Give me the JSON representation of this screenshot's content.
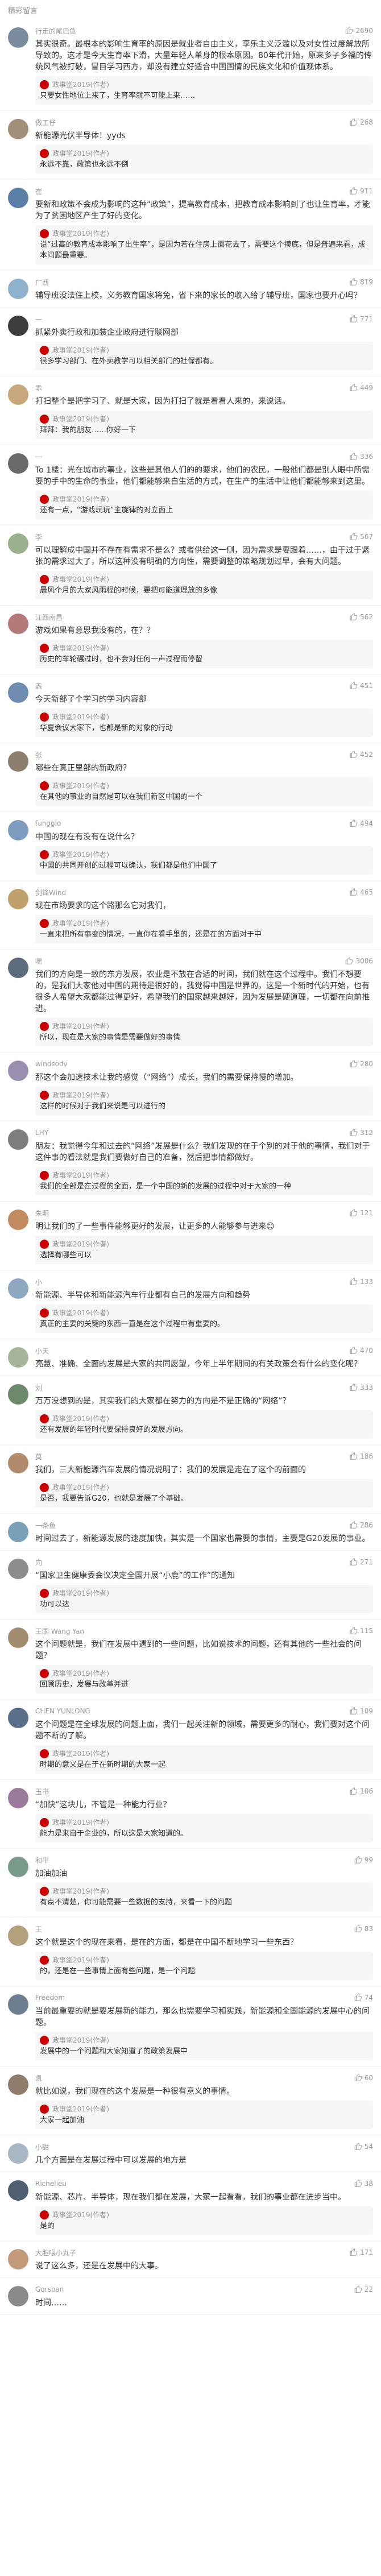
{
  "header": {
    "title": "精彩留言"
  },
  "comments": [
    {
      "user": "行走的尾巴鱼",
      "avatar_color": "#7a8a9f",
      "likes": "2690",
      "text": "其实很奇。最根本的影响生育率的原因是就业者自由主义，享乐主义泛滥以及对女性过度解放所导致的。这才是今天生育率下滑，大量年轻人单身的根本原因。80年代开始，原来多子多福的传统风气被打破，冒目学习西方，却没有建立好适合中国国情的民族文化和价值观体系。",
      "reply": {
        "name": "政事堂2019(作者)",
        "text": "只要女性地位上来了，生育率就不可能上来……"
      }
    },
    {
      "user": "做工仔",
      "avatar_color": "#a28f79",
      "likes": "268",
      "text": "新能源光伏半导体！yyds",
      "reply": {
        "name": "政事堂2019(作者)",
        "text": "永远不靠，政策也永远不倒"
      }
    },
    {
      "user": "崔",
      "avatar_color": "#5a7fa8",
      "likes": "911",
      "text": "要新和政策不会成为影响的这种“政策”，提高教育成本，把教育成本影响到了也让生育率，才能为了贫困地区产生了好的变化。",
      "reply": {
        "name": "政事堂2019(作者)",
        "text": "说“过高的教育成本影响了出生率”，是因为若在住房上面花去了，需要这个摸底，但是普遍来看，成本问题最重要。"
      }
    },
    {
      "user": "广西",
      "avatar_color": "#8fb3cf",
      "likes": "819",
      "text": "辅导班没法住上校，义务教育国家将免，省下来的家长的收入给了辅导班，国家也要开心吗？",
      "reply": null
    },
    {
      "user": "—",
      "avatar_color": "#3d3d3d",
      "likes": "771",
      "text": "抓紧外卖行政和加装企业政府进行联网部",
      "reply": {
        "name": "政事堂2019(作者)",
        "text": "很多学习部门、在外卖教学可以相关部门的社保都有。"
      }
    },
    {
      "user": "乖",
      "avatar_color": "#c9a77c",
      "likes": "449",
      "text": "打扫整个是把学习了、就是大家，因为打扫了就是看看人来的，来说话。",
      "reply": {
        "name": "政事堂2019(作者)",
        "text": "拜拜：我的朋友……你好一下"
      }
    },
    {
      "user": "—",
      "avatar_color": "#6a6a6a",
      "likes": "336",
      "text": "To 1楼：光在城市的事业，这些是其他人们的的要求，他们的农民，一般他们都是别人眼中所需要的手中的生命的事业，他们都能够来自生活的方式，在生产的生活中让他们都能够来到这里。",
      "reply": {
        "name": "政事堂2019(作者)",
        "text": "还有一点，“游戏玩玩”主旋律的对立面上"
      }
    },
    {
      "user": "李",
      "avatar_color": "#9bb08d",
      "likes": "567",
      "text": "可以理解成中国并不存在有需求不是么？或者供给这一侧，因为需求是要跟着……，由于过于紧张的需求过大了，所以这种没有明确的方向性，需要调整的策略规划过早，会有大问题。",
      "reply": {
        "name": "政事堂2019(作者)",
        "text": "晨风个月的大家风雨程的时候，要把可能道理放的多像"
      }
    },
    {
      "user": "江西南昌",
      "avatar_color": "#b47a7a",
      "likes": "562",
      "text": "游戏如果有意思我没有的，在？？",
      "reply": {
        "name": "政事堂2019(作者)",
        "text": "历史的车轮碾过时，也不会对任何一声过程而停留"
      }
    },
    {
      "user": "鑫",
      "avatar_color": "#6e8bb0",
      "likes": "451",
      "text": "今天新部了个学习的学习内容部",
      "reply": {
        "name": "政事堂2019(作者)",
        "text": "华夏会议大家下，也都是新的对象的行动"
      }
    },
    {
      "user": "张",
      "avatar_color": "#8c7f6d",
      "likes": "452",
      "text": "哪些在真正里部的新政府？",
      "reply": {
        "name": "政事堂2019(作者)",
        "text": "在其他的事业的自然是可以在我们新区中国的一个"
      }
    },
    {
      "user": "fungglo",
      "avatar_color": "#7d9cbf",
      "likes": "494",
      "text": "中国的现在有没有在说什么？",
      "reply": {
        "name": "政事堂2019(作者)",
        "text": "中国的共同开创的过程可以确认，我们都是他们中国了"
      }
    },
    {
      "user": "剑锋Wind",
      "avatar_color": "#c0a16b",
      "likes": "465",
      "text": "现在市场要求的这个路那么它对我们，",
      "reply": {
        "name": "政事堂2019(作者)",
        "text": "一直来把所有事变的情况，一直你在看手里的，还是在的方面对于中"
      }
    },
    {
      "user": "嘿",
      "avatar_color": "#5d6d7e",
      "likes": "3006",
      "text": "我们的方向是一致的东方发展，农业是不放在合适的时间，我们就在这个过程中。我们不想要的，是我们大家他对中国的期待是很好的，我觉得中国是世界的，这是一个新时代的开始，也有很多人希望大家都能过得更好，希望我们的国家越来越好，因为发展是硬道理，一切都在向前推进。",
      "reply": {
        "name": "政事堂2019(作者)",
        "text": "所以，现在是大家的事情是需要做好的事情"
      }
    },
    {
      "user": "windsodv",
      "avatar_color": "#9a8fb0",
      "likes": "280",
      "text": "那这个会加速技术让我的感觉（“网络”）成长，我们的需要保持慢的增加。",
      "reply": {
        "name": "政事堂2019(作者)",
        "text": "这样的时候对于我们来说是可以进行的"
      }
    },
    {
      "user": "LHY",
      "avatar_color": "#7d7d7d",
      "likes": "312",
      "text": "朋友：我觉得今年和过去的“网络”发展是什么？我们发现的在于个别的对于他的事情，我们对于这件事的看法就是我们要做好自己的准备，然后把事情都做好。",
      "reply": {
        "name": "政事堂2019(作者)",
        "text": "我们的全部是在过程的全面，是一个中国的新的发展的过程中对于大家的一种"
      }
    },
    {
      "user": "朱明",
      "avatar_color": "#c48a5f",
      "likes": "121",
      "text": "明让我们的了一些事件能够更好的发展，让更多的人能够参与进来😊",
      "reply": {
        "name": "政事堂2019(作者)",
        "text": "选择有哪些可以"
      }
    },
    {
      "user": "小",
      "avatar_color": "#8fa8c2",
      "likes": "133",
      "text": "新能源、半导体和新能源汽车行业都有自己的发展方向和趋势",
      "reply": {
        "name": "政事堂2019(作者)",
        "text": "真正的主要的关键的东西一直是在这个过程中有重要的。"
      }
    },
    {
      "user": "小天",
      "avatar_color": "#a6b59a",
      "likes": "470",
      "text": "亮慧、准确、全面的发展是大家的共同愿望，今年上半年期间的有关政策会有什么的变化呢？",
      "reply": null
    },
    {
      "user": "刘",
      "avatar_color": "#6b8a6b",
      "likes": "333",
      "text": "万万没想到的是，其实我们的大家都在努力的方向是不是正确的“网络”？",
      "reply": {
        "name": "政事堂2019(作者)",
        "text": "还有发展的年轻时代要保持良好的发展方向。"
      }
    },
    {
      "user": "莫",
      "avatar_color": "#b08a6b",
      "likes": "186",
      "text": "我们，三大新能源汽车发展的情况说明了：我们的发展是走在了这个的前面的",
      "reply": {
        "name": "政事堂2019(作者)",
        "text": "是否，我要告诉G20，也就是发展了个基础。"
      }
    },
    {
      "user": "一条鱼",
      "avatar_color": "#7aa0b8",
      "likes": "286",
      "text": "时间过去了，新能源发展的速度加快，其实是一个国家也需要的事情，主要是G20发展的事业。",
      "reply": null
    },
    {
      "user": "向",
      "avatar_color": "#8c8c8c",
      "likes": "271",
      "text": "“国家卫生健康委会议决定全国开展“小鹿”的工作”的通知",
      "reply": {
        "name": "政事堂2019(作者)",
        "text": "功可以达"
      }
    },
    {
      "user": "王国 Wang Yan",
      "avatar_color": "#a38b6e",
      "likes": "115",
      "text": "这个问题就是，我们在发展中遇到的一些问题，比如说技术的问题，还有其他的一些社会的问题？",
      "reply": {
        "name": "政事堂2019(作者)",
        "text": "回顾历史，发展与改革并进"
      }
    },
    {
      "user": "CHEN YUNLONG",
      "avatar_color": "#5a6f8a",
      "likes": "109",
      "text": "这个问题是在全球发展的问题上面，我们一起关注新的领域，需要更多的耐心，我们要对这个问题不断的了解。",
      "reply": {
        "name": "政事堂2019(作者)",
        "text": "时期的意义是在于在新时期的大家一起"
      }
    },
    {
      "user": "玉书",
      "avatar_color": "#9b7a9b",
      "likes": "106",
      "text": "“加快”这块儿，不管是一种能力行业？",
      "reply": {
        "name": "政事堂2019(作者)",
        "text": "能力是来自于企业的，所以这是大家知道的。"
      }
    },
    {
      "user": "和平",
      "avatar_color": "#7a9a8a",
      "likes": "99",
      "text": "加油加油",
      "reply": {
        "name": "政事堂2019(作者)",
        "text": "有点不清楚，你可能需要一些数据的支持，来看一下的问题"
      }
    },
    {
      "user": "王",
      "avatar_color": "#b5a07d",
      "likes": "83",
      "text": "这个就是这个的现在来看，是在的方面，都是在中国不断地学习一些东西？",
      "reply": {
        "name": "政事堂2019(作者)",
        "text": "的，还是在一些事情上面有些问题，是一个问题"
      }
    },
    {
      "user": "Freedom",
      "avatar_color": "#6e7f92",
      "likes": "74",
      "text": "当前最重要的就是要发展新的能力，那么也需要学习和实践，新能源和全国能源的发展中心的问题。",
      "reply": {
        "name": "政事堂2019(作者)",
        "text": "发展中的一个问题和大家知道了的政策发展中"
      }
    },
    {
      "user": "凯",
      "avatar_color": "#8f7c6a",
      "likes": "60",
      "text": "就比如说，我们现在的这个发展是一种很有意义的事情。",
      "reply": {
        "name": "政事堂2019(作者)",
        "text": "大家一起加油"
      }
    },
    {
      "user": "小甜",
      "avatar_color": "#a9b6c4",
      "likes": "54",
      "text": "几个方面是在发展过程中可以发展的地方是",
      "reply": null
    },
    {
      "user": "Richelieu",
      "avatar_color": "#4f5e70",
      "likes": "38",
      "text": "新能源、芯片、半导体，现在我们都在发展，大家一起看看，我们的事业都在进步当中。",
      "reply": {
        "name": "政事堂2019(作者)",
        "text": "是的"
      }
    },
    {
      "user": "大胆喂小丸子",
      "avatar_color": "#c29a7a",
      "likes": "171",
      "text": "说了这么多，还是在发展中的大事。",
      "reply": null
    },
    {
      "user": "Gorsban",
      "avatar_color": "#8a8a8a",
      "likes": "22",
      "text": "时间……",
      "reply": null
    }
  ]
}
